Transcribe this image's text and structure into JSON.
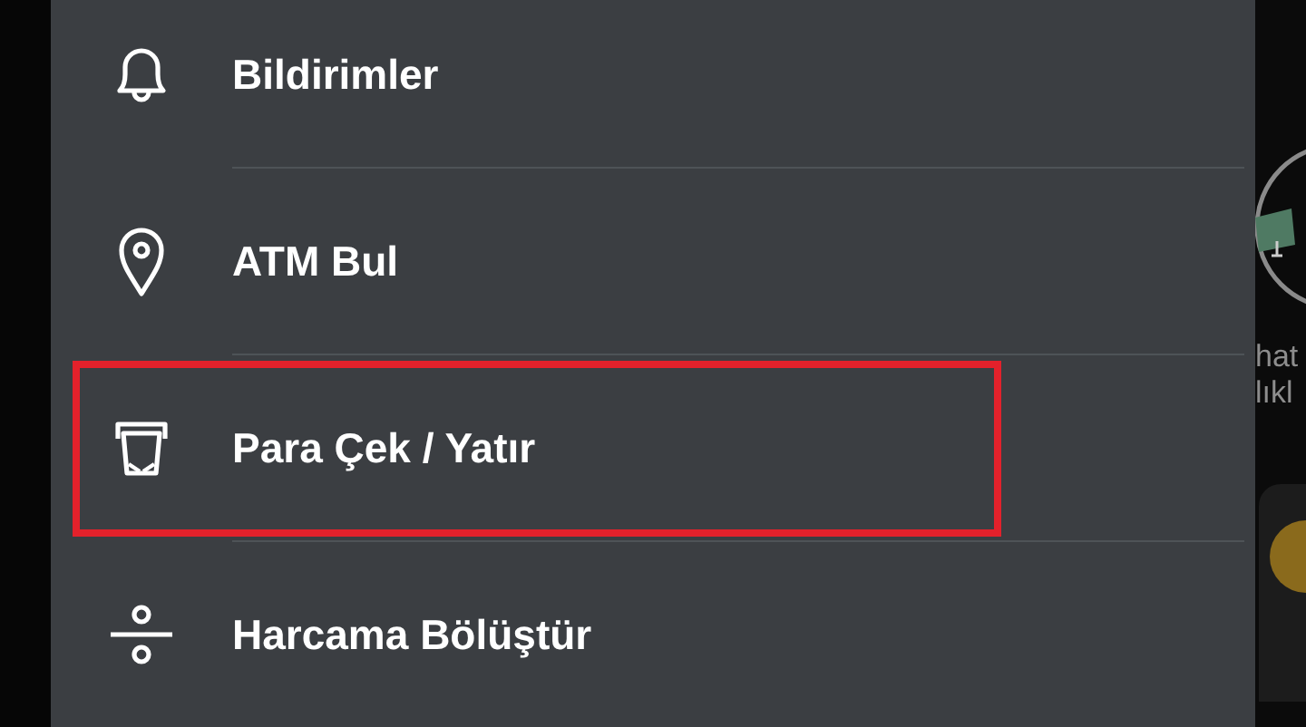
{
  "menu": {
    "items": [
      {
        "kind": "bell",
        "label": "Bildirimler",
        "highlighted": false
      },
      {
        "kind": "pin",
        "label": "ATM Bul",
        "highlighted": false
      },
      {
        "kind": "atm",
        "label": "Para Çek / Yatır",
        "highlighted": true
      },
      {
        "kind": "split",
        "label": "Harcama Bölüştür",
        "highlighted": false
      }
    ]
  },
  "background_app": {
    "label_lines": [
      "hat",
      "lıkl"
    ]
  }
}
